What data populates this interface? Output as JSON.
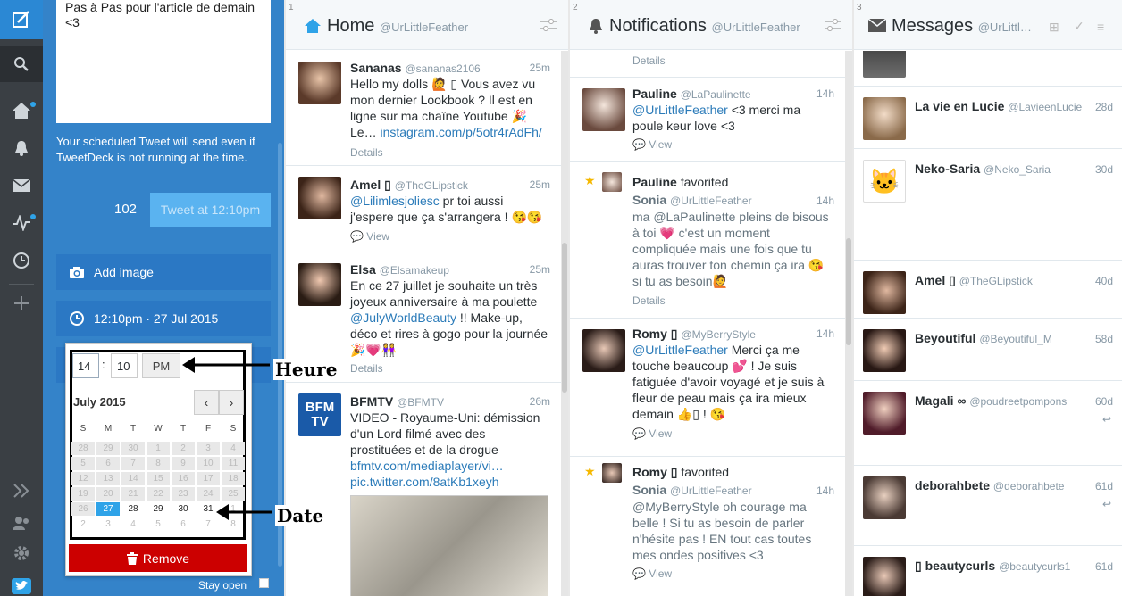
{
  "compose": {
    "text": "Pas à Pas pour l'article de demain <3",
    "schedule_note": "Your scheduled Tweet will send even if TweetDeck is not running at the time.",
    "char_count": "102",
    "tweet_button": "Tweet at 12:10pm",
    "add_image": "Add image",
    "schedule_date": "12:10pm · 27 Jul 2015",
    "stay_open": "Stay open"
  },
  "picker": {
    "hour": "14",
    "minute": "10",
    "ampm": "PM",
    "month_label": "July 2015",
    "weekdays": [
      "S",
      "M",
      "T",
      "W",
      "T",
      "F",
      "S"
    ],
    "weeks": [
      [
        "28",
        "29",
        "30",
        "1",
        "2",
        "3",
        "4"
      ],
      [
        "5",
        "6",
        "7",
        "8",
        "9",
        "10",
        "11"
      ],
      [
        "12",
        "13",
        "14",
        "15",
        "16",
        "17",
        "18"
      ],
      [
        "19",
        "20",
        "21",
        "22",
        "23",
        "24",
        "25"
      ],
      [
        "26",
        "27",
        "28",
        "29",
        "30",
        "31",
        "1"
      ],
      [
        "2",
        "3",
        "4",
        "5",
        "6",
        "7",
        "8"
      ]
    ],
    "selected_day": "27",
    "remove_label": "Remove"
  },
  "annotations": {
    "hour": "Heure",
    "date": "Date"
  },
  "columns": {
    "home": {
      "num": "1",
      "title": "Home",
      "handle": "@UrLittleFeather"
    },
    "notifications": {
      "num": "2",
      "title": "Notifications",
      "handle": "@UrLittleFeather"
    },
    "messages": {
      "num": "3",
      "title": "Messages",
      "handle": "@UrLittl…"
    }
  },
  "home_tweets": [
    {
      "name": "Sananas",
      "handle": "@sananas2106",
      "time": "25m",
      "text": "Hello my dolls 🙋 ▯ Vous avez vu mon dernier Lookbook ? Il est en ligne sur ma chaîne Youtube 🎉 Le… ",
      "link": "instagram.com/p/5otr4rAdFh/",
      "meta": "Details"
    },
    {
      "name": "Amel ▯",
      "handle": "@TheGLipstick",
      "time": "25m",
      "link": "@Lilimlesjoliesc",
      "text": " pr toi aussi j'espere que ça s'arrangera ! 😘😘",
      "meta": "View"
    },
    {
      "name": "Elsa",
      "handle": "@Elsamakeup",
      "time": "25m",
      "text": "En ce 27 juillet je souhaite un très joyeux anniversaire à ma poulette ",
      "link": "@JulyWorldBeauty",
      "text2": " !! Make-up, déco et rires à gogo pour la journée 🎉💗👭",
      "meta": "Details"
    },
    {
      "name": "BFMTV",
      "handle": "@BFMTV",
      "time": "26m",
      "text": "VIDEO - Royaume-Uni: démission d'un Lord filmé avec des prostituées et de la drogue",
      "link": "bfmtv.com/mediaplayer/vi…",
      "link2": "pic.twitter.com/8atKb1xeyh"
    }
  ],
  "notif_items": [
    {
      "meta": "Details"
    },
    {
      "name": "Pauline",
      "handle": "@LaPaulinette",
      "time": "14h",
      "link": "@UrLittleFeather",
      "text": " <3 merci ma poule keur love <3",
      "meta": "View"
    },
    {
      "action_name": "Pauline",
      "action": "favorited",
      "name": "Sonia",
      "handle": "@UrLittleFeather",
      "time": "14h",
      "text": "ma @LaPaulinette pleins de bisous à toi 💗 c'est un moment compliquée mais une fois que tu auras trouver ton chemin ça ira 😘 si tu as besoin🙋",
      "meta": "Details"
    },
    {
      "name": "Romy ▯",
      "handle": "@MyBerryStyle",
      "time": "14h",
      "link": "@UrLittleFeather",
      "text": " Merci ça me touche beaucoup 💕 ! Je suis fatiguée d'avoir voyagé et je suis à fleur de peau mais ça ira mieux demain 👍▯ ! 😘",
      "meta": "View"
    },
    {
      "action_name": "Romy ▯",
      "action": "favorited",
      "name": "Sonia",
      "handle": "@UrLittleFeather",
      "time": "14h",
      "text": "@MyBerryStyle oh courage ma belle ! Si tu as besoin de parler n'hésite pas ! EN tout cas toutes mes ondes positives <3",
      "meta": "View"
    }
  ],
  "messages": [
    {
      "name": "La vie en Lucie",
      "handle": "@LavieenLucie",
      "time": "28d"
    },
    {
      "name": "Neko-Saria",
      "handle": "@Neko_Saria",
      "time": "30d"
    },
    {
      "name": "Amel ▯",
      "handle": "@TheGLipstick",
      "time": "40d"
    },
    {
      "name": "Beyoutiful",
      "handle": "@Beyoutiful_M",
      "time": "58d"
    },
    {
      "name": "Magali ∞",
      "handle": "@poudreetpompons",
      "time": "60d"
    },
    {
      "name": "deborahbete",
      "handle": "@deborahbete",
      "time": "61d"
    },
    {
      "name": "▯ beautycurls",
      "handle": "@beautycurls1",
      "time": "61d"
    }
  ],
  "colors": {
    "accent": "#2b7bb9",
    "compose_bg": "#3483c9",
    "remove_red": "#cc0000",
    "nav_bg": "#3a3f44"
  }
}
